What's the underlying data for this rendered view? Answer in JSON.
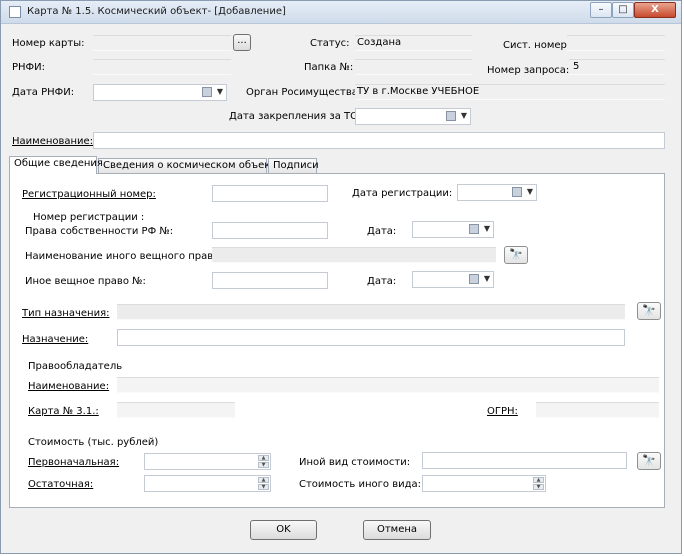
{
  "window": {
    "title": "Карта № 1.5. Космический объект- [Добавление]",
    "close_glyph": "X",
    "minimize_glyph": "–",
    "maximize_glyph": "□"
  },
  "header": {
    "card_number_label": "Номер карты:",
    "card_number_value": "",
    "browse_label": "...",
    "status_label": "Статус:",
    "status_value": "Создана",
    "sys_number_label": "Сист. номер.",
    "sys_number_value": "",
    "rnfi_label": "РНФИ:",
    "rnfi_value": "",
    "folder_label": "Папка №:",
    "folder_value": "",
    "request_number_label": "Номер запроса:",
    "request_number_value": "5",
    "rnfi_date_label": "Дата РНФИ:",
    "rnfi_date_value": "",
    "authority_label": "Орган Росимущества:",
    "authority_value": "ТУ в г.Москве УЧЕБНОЕ",
    "assign_date_label": "Дата закрепления за ТО:",
    "assign_date_value": "",
    "name_label": "Наименование:",
    "name_value": ""
  },
  "tabs": [
    {
      "label": "Общие сведения"
    },
    {
      "label": "Сведения о космическом объекте"
    },
    {
      "label": "Подписи"
    }
  ],
  "general": {
    "reg_number_label": "Регистрационный номер:",
    "reg_number_value": "",
    "reg_date_label": "Дата регистрации:",
    "reg_date_value": "",
    "reg_no_heading": "Номер регистрации :",
    "ownership_label": "Права собственности РФ №:",
    "ownership_value": "",
    "date_label_1": "Дата:",
    "date_value_1": "",
    "other_right_name_label": "Наименование иного вещного права:",
    "other_right_name_value": "",
    "other_right_no_label": "Иное вещное право №:",
    "other_right_no_value": "",
    "date_label_2": "Дата:",
    "date_value_2": "",
    "purpose_type_label": "Тип назначения:",
    "purpose_type_value": "",
    "purpose_label": "Назначение:",
    "purpose_value": "",
    "holder_heading": "Правообладатель",
    "holder_name_label": "Наименование:",
    "holder_name_value": "",
    "card31_label": "Карта № 3.1.:",
    "card31_value": "",
    "ogrn_label": "ОГРН:",
    "ogrn_value": "",
    "cost_heading": "Стоимость (тыс. рублей)",
    "initial_label": "Первоначальная:",
    "initial_value": "",
    "residual_label": "Остаточная:",
    "residual_value": "",
    "other_cost_type_label": "Иной вид стоимости:",
    "other_cost_type_value": "",
    "other_cost_label": "Стоимость иного вида:",
    "other_cost_value": ""
  },
  "footer": {
    "ok_label": "OK",
    "cancel_label": "Отмена"
  },
  "icons": {
    "binoculars": "binoculars-icon",
    "calendar": "calendar-icon",
    "dropdown": "chevron-down-icon"
  }
}
